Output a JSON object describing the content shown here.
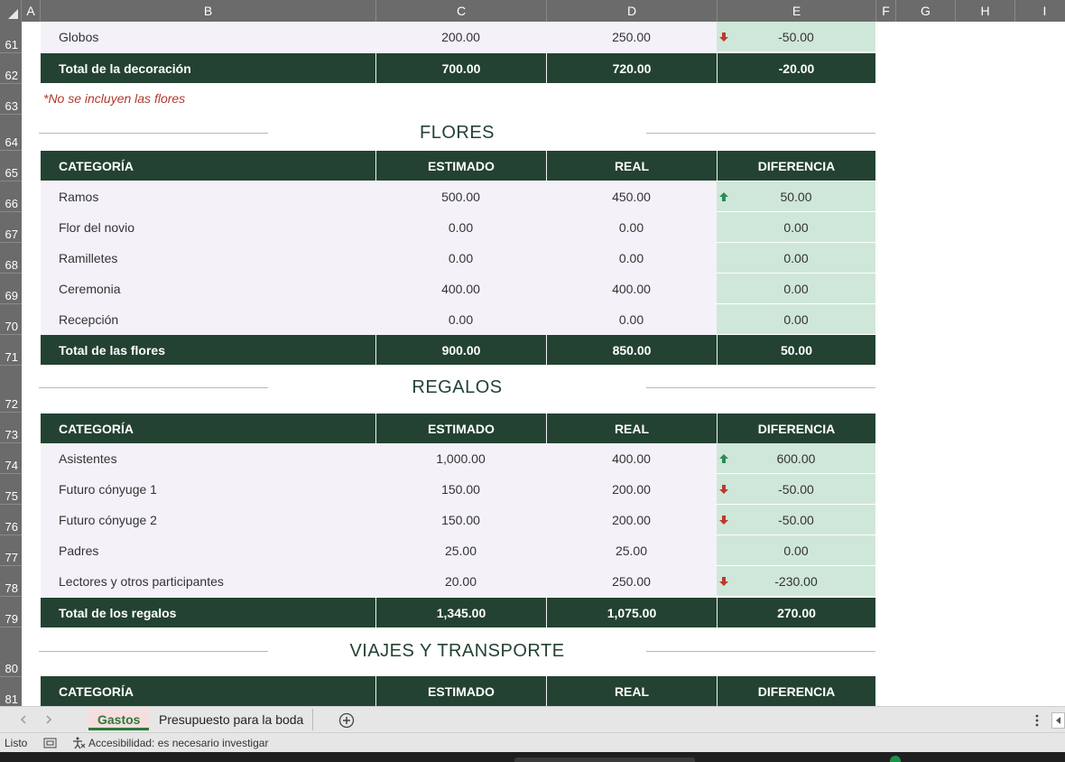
{
  "columns": [
    "A",
    "B",
    "C",
    "D",
    "E",
    "F",
    "G",
    "H",
    "I"
  ],
  "rows": [
    "61",
    "62",
    "63",
    "64",
    "65",
    "66",
    "67",
    "68",
    "69",
    "70",
    "71",
    "72",
    "73",
    "74",
    "75",
    "76",
    "77",
    "78",
    "79",
    "80",
    "81"
  ],
  "table_header": {
    "categoria": "CATEGORÍA",
    "estimado": "ESTIMADO",
    "real": "REAL",
    "diferencia": "DIFERENCIA"
  },
  "decoracion": {
    "last_row": {
      "cat": "Globos",
      "est": "200.00",
      "real": "250.00",
      "dif": "-50.00",
      "arrow": "down"
    },
    "total": {
      "label": "Total de la decoración",
      "est": "700.00",
      "real": "720.00",
      "dif": "-20.00"
    },
    "note": "*No se incluyen las flores"
  },
  "flores": {
    "title": "FLORES",
    "rows": [
      {
        "cat": "Ramos",
        "est": "500.00",
        "real": "450.00",
        "dif": "50.00",
        "arrow": "up"
      },
      {
        "cat": "Flor del novio",
        "est": "0.00",
        "real": "0.00",
        "dif": "0.00",
        "arrow": ""
      },
      {
        "cat": "Ramilletes",
        "est": "0.00",
        "real": "0.00",
        "dif": "0.00",
        "arrow": ""
      },
      {
        "cat": "Ceremonia",
        "est": "400.00",
        "real": "400.00",
        "dif": "0.00",
        "arrow": ""
      },
      {
        "cat": "Recepción",
        "est": "0.00",
        "real": "0.00",
        "dif": "0.00",
        "arrow": ""
      }
    ],
    "total": {
      "label": "Total de las flores",
      "est": "900.00",
      "real": "850.00",
      "dif": "50.00"
    }
  },
  "regalos": {
    "title": "REGALOS",
    "rows": [
      {
        "cat": "Asistentes",
        "est": "1,000.00",
        "real": "400.00",
        "dif": "600.00",
        "arrow": "up"
      },
      {
        "cat": "Futuro cónyuge 1",
        "est": "150.00",
        "real": "200.00",
        "dif": "-50.00",
        "arrow": "down"
      },
      {
        "cat": "Futuro cónyuge 2",
        "est": "150.00",
        "real": "200.00",
        "dif": "-50.00",
        "arrow": "down"
      },
      {
        "cat": "Padres",
        "est": "25.00",
        "real": "25.00",
        "dif": "0.00",
        "arrow": ""
      },
      {
        "cat": "Lectores y otros participantes",
        "est": "20.00",
        "real": "250.00",
        "dif": "-230.00",
        "arrow": "down"
      }
    ],
    "total": {
      "label": "Total de los regalos",
      "est": "1,345.00",
      "real": "1,075.00",
      "dif": "270.00"
    }
  },
  "viajes": {
    "title": "VIAJES Y TRANSPORTE"
  },
  "tabs": {
    "active": "Gastos",
    "other": "Presupuesto para la boda"
  },
  "status": {
    "ready": "Listo",
    "accessibility": "Accesibilidad: es necesario investigar"
  },
  "colors": {
    "header_green": "#234232",
    "diff_fill": "#cfe7d9",
    "row_fill": "#f4f2f8",
    "up_arrow": "#2e8b57",
    "down_arrow": "#c0392b"
  }
}
